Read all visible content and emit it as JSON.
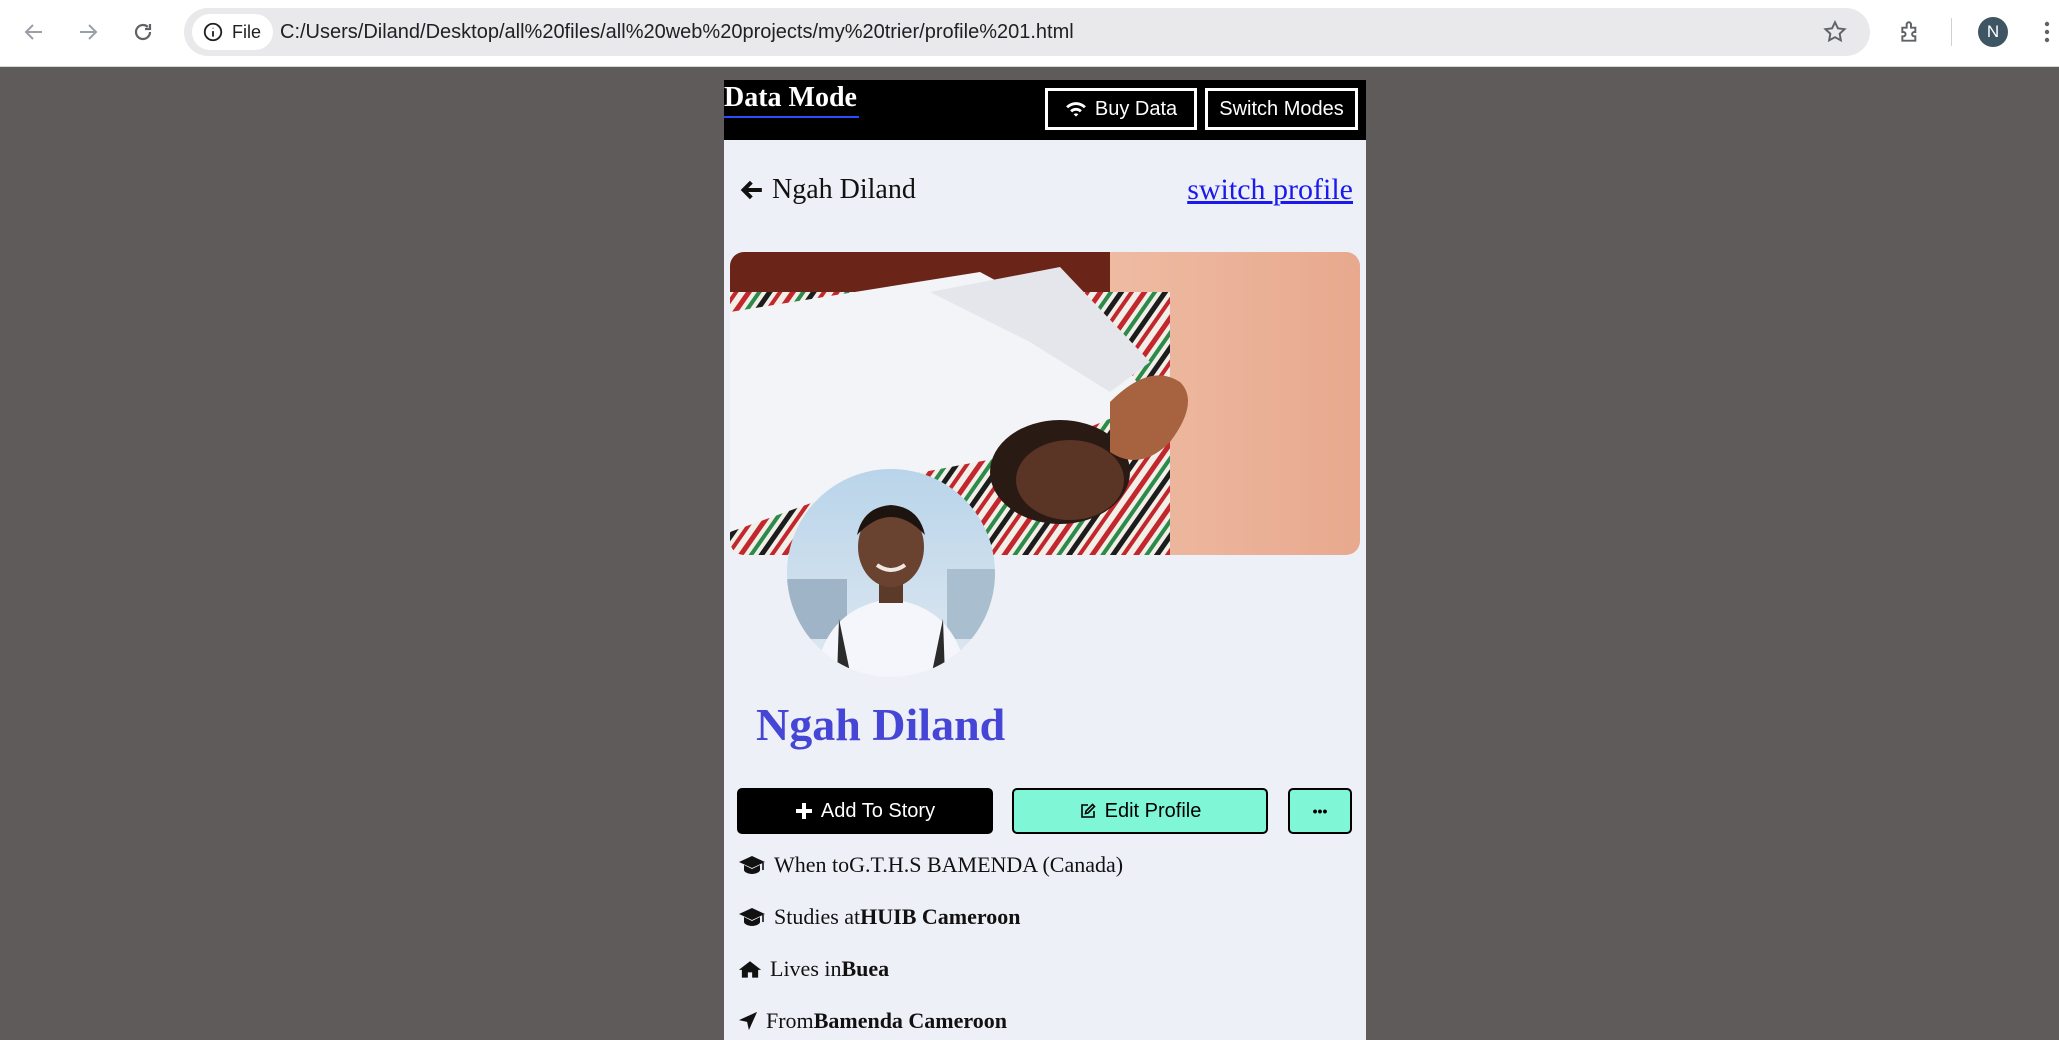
{
  "browser": {
    "chip_label": "File",
    "url": "C:/Users/Diland/Desktop/all%20files/all%20web%20projects/my%20trier/profile%201.html",
    "profile_initial": "N"
  },
  "topbar": {
    "brand": "Data Mode",
    "buy_data_label": "Buy Data",
    "switch_modes_label": "Switch Modes"
  },
  "header": {
    "name": "Ngah Diland",
    "switch_profile_label": "switch profile"
  },
  "profile": {
    "display_name": "Ngah Diland"
  },
  "actions": {
    "add_story_label": "Add To Story",
    "edit_profile_label": "Edit Profile",
    "more_label": "•••",
    "accent_color": "#7ff7d6"
  },
  "info": [
    {
      "icon": "graduation-cap-icon",
      "prefix": "When to ",
      "bold": "",
      "suffix": "G.T.H.S BAMENDA (Canada)"
    },
    {
      "icon": "graduation-cap-icon",
      "prefix": "Studies at ",
      "bold": "HUIB Cameroon",
      "suffix": ""
    },
    {
      "icon": "home-icon",
      "prefix": "Lives in ",
      "bold": "Buea",
      "suffix": ""
    },
    {
      "icon": "location-arrow-icon",
      "prefix": "From ",
      "bold": "Bamenda Cameroon",
      "suffix": ""
    }
  ]
}
